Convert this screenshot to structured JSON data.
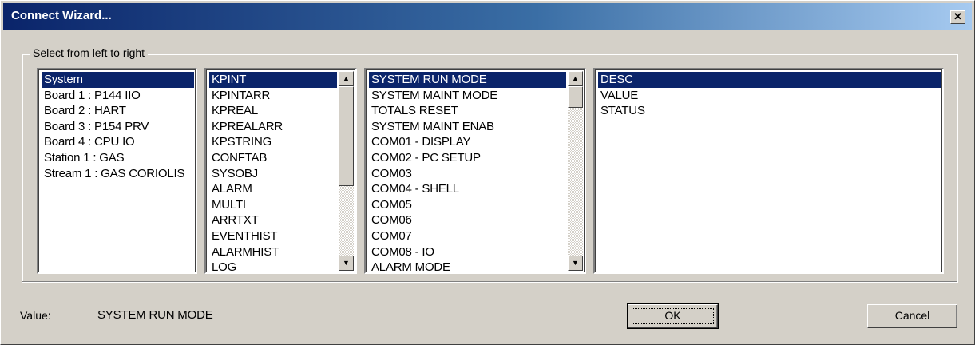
{
  "window": {
    "title": "Connect Wizard...",
    "close_glyph": "✕"
  },
  "group": {
    "label": "Select from left to right"
  },
  "lists": {
    "sources": {
      "items": [
        "System",
        "Board 1 : P144 IIO",
        "Board 2 : HART",
        "Board 3 : P154 PRV",
        "Board 4 : CPU IO",
        "Station 1 : GAS",
        "Stream 1 : GAS CORIOLIS"
      ],
      "selected": "System"
    },
    "objects": {
      "items": [
        "KPINT",
        "KPINTARR",
        "KPREAL",
        "KPREALARR",
        "KPSTRING",
        "CONFTAB",
        "SYSOBJ",
        "ALARM",
        "MULTI",
        "ARRTXT",
        "EVENTHIST",
        "ALARMHIST",
        "LOG"
      ],
      "selected": "KPINT"
    },
    "variables": {
      "items": [
        "SYSTEM RUN MODE",
        "SYSTEM MAINT MODE",
        "TOTALS RESET",
        "SYSTEM MAINT ENAB",
        "COM01 - DISPLAY",
        "COM02 - PC SETUP",
        "COM03",
        "COM04 - SHELL",
        "COM05",
        "COM06",
        "COM07",
        "COM08 - IO",
        "ALARM MODE"
      ],
      "selected": "SYSTEM RUN MODE"
    },
    "fields": {
      "items": [
        "DESC",
        "VALUE",
        "STATUS"
      ],
      "selected": "DESC"
    }
  },
  "footer": {
    "value_label": "Value:",
    "value_text": "SYSTEM RUN MODE",
    "ok_label": "OK",
    "cancel_label": "Cancel"
  },
  "icons": {
    "scroll_up": "▲",
    "scroll_down": "▼"
  },
  "colors": {
    "title_start": "#0a246a",
    "title_end": "#a6caf0",
    "selection": "#0a246a",
    "face": "#d4d0c8"
  }
}
